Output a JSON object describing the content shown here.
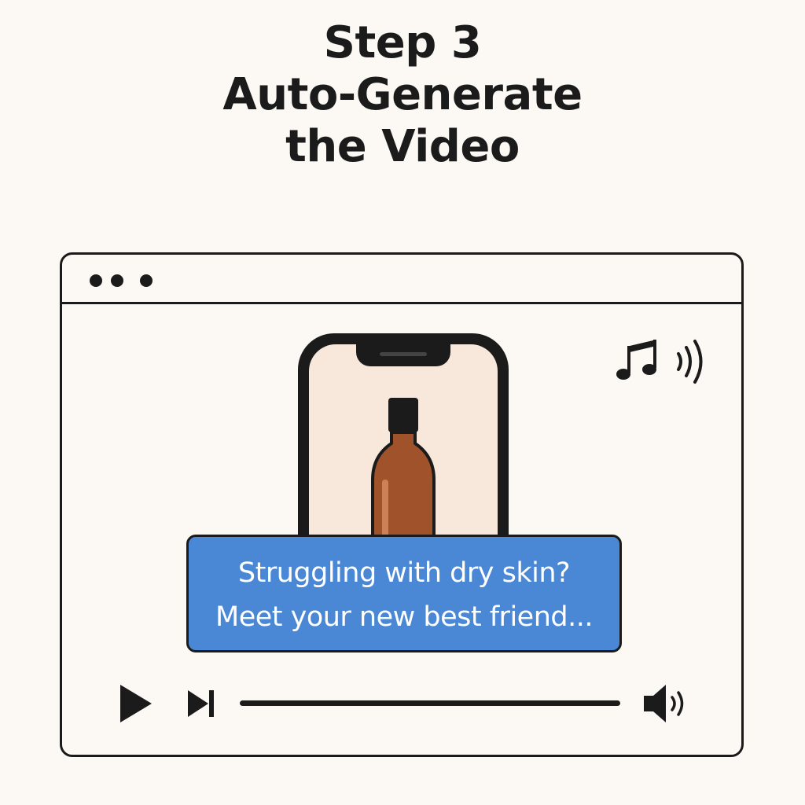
{
  "heading": {
    "line1": "Step 3",
    "line2": "Auto-Generate",
    "line3": "the Video"
  },
  "window": {
    "titlebar_dots": 3
  },
  "player": {
    "caption_line1": "Struggling with dry skin?",
    "caption_line2": "Meet your new best friend...",
    "progress": 1.0,
    "icons": {
      "play": "play-icon",
      "next": "skip-next-icon",
      "volume": "volume-icon",
      "music": "music-note-icon",
      "sound": "sound-waves-icon",
      "product": "amber-bottle"
    }
  },
  "colors": {
    "background": "#fcf9f5",
    "ink": "#1b1b1b",
    "caption_bg": "#4a88d6",
    "caption_text": "#ffffff",
    "bottle": "#a0532b",
    "phone_screen": "#f8e8dc"
  }
}
